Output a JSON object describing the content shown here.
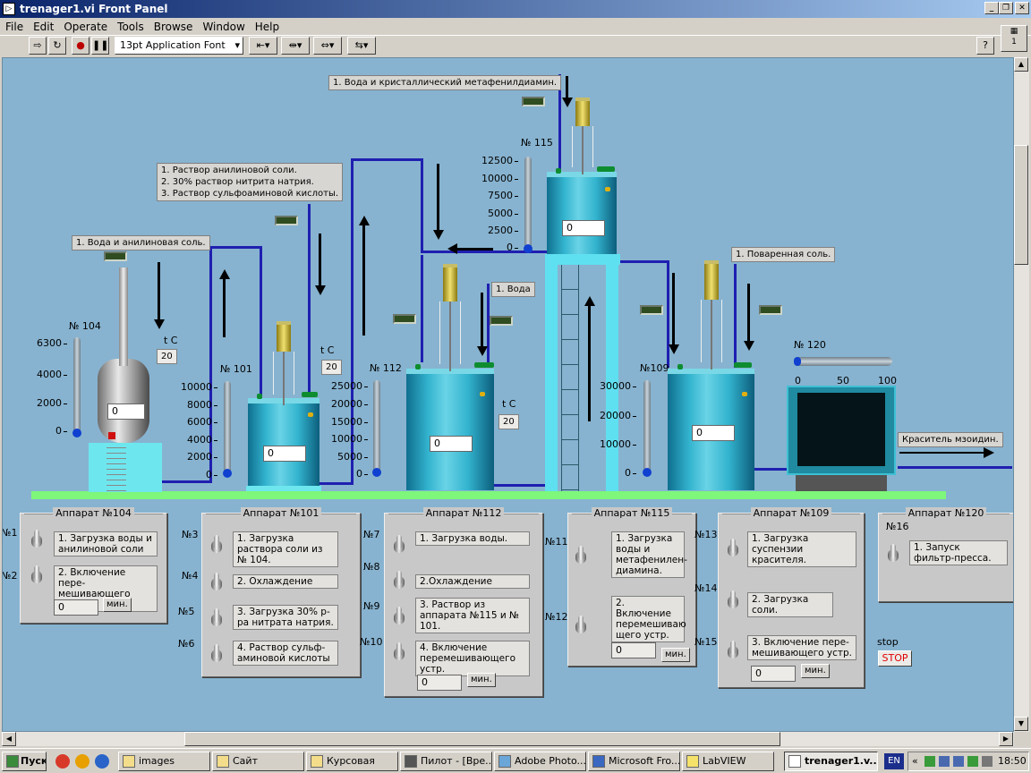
{
  "window": {
    "title": "trenager1.vi Front Panel",
    "icon": "labview-icon"
  },
  "menu": [
    "File",
    "Edit",
    "Operate",
    "Tools",
    "Browse",
    "Window",
    "Help"
  ],
  "toolbar": {
    "font": "13pt Application Font",
    "palette_number": "1"
  },
  "colors": {
    "panel": "#87b3d0",
    "pipe": "#1f1fb0",
    "ground": "#7ef77a",
    "tank": "#33b4cf"
  },
  "inlets": {
    "i104": "1. Вода и анилиновая соль.",
    "i101": [
      "1. Раствор анилиновой соли.",
      "2. 30% раствор нитрита натрия.",
      "3. Раствор сульфоаминовой кислоты."
    ],
    "i115": "1. Вода и кристаллический метафенилдиамин.",
    "i112": "1. Вода",
    "i109": "1. Поваренная соль."
  },
  "outlet": "Краситель мзоидин.",
  "tanks": {
    "t104": {
      "name": "№ 104",
      "value": "0",
      "ticks": [
        "6300",
        "4000",
        "2000",
        "0"
      ]
    },
    "t101": {
      "name": "№ 101",
      "value": "0",
      "ticks": [
        "10000",
        "8000",
        "6000",
        "4000",
        "2000",
        "0"
      ]
    },
    "t112": {
      "name": "№ 112",
      "value": "0",
      "ticks": [
        "25000",
        "20000",
        "15000",
        "10000",
        "5000",
        "0"
      ]
    },
    "t115": {
      "name": "№ 115",
      "value": "0",
      "ticks": [
        "12500",
        "10000",
        "7500",
        "5000",
        "2500",
        "0"
      ]
    },
    "t109": {
      "name": "№109",
      "value": "0",
      "ticks": [
        "30000",
        "20000",
        "10000",
        "0"
      ]
    },
    "t120": {
      "name": "№ 120",
      "ticks": [
        "0",
        "50",
        "100"
      ]
    }
  },
  "temps": {
    "label": "t C",
    "t104": "20",
    "t101": "20",
    "t112": "20"
  },
  "panels": {
    "a104": {
      "title": "Аппарат №104",
      "items": [
        {
          "n": "№1",
          "label": "1. Загрузка воды и анилиновой соли"
        },
        {
          "n": "№2",
          "label": "2. Включение пере-мешивающего устр."
        }
      ],
      "time": "0",
      "unit": "мин."
    },
    "a101": {
      "title": "Аппарат №101",
      "items": [
        {
          "n": "№3",
          "label": "1. Загрузка раствора соли из № 104."
        },
        {
          "n": "№4",
          "label": "2. Охлаждение"
        },
        {
          "n": "№5",
          "label": "3. Загрузка 30% р-ра нитрата натрия."
        },
        {
          "n": "№6",
          "label": "4. Раствор сульф-аминовой кислоты"
        }
      ]
    },
    "a112": {
      "title": "Аппарат №112",
      "items": [
        {
          "n": "№7",
          "label": "1. Загрузка воды."
        },
        {
          "n": "№8",
          "label": "2.Охлаждение"
        },
        {
          "n": "№9",
          "label": "3. Раствор из аппарата №115 и № 101."
        },
        {
          "n": "№10",
          "label": "4. Включение перемешивающего устр."
        }
      ],
      "time": "0",
      "unit": "мин."
    },
    "a115": {
      "title": "Аппарат №115",
      "items": [
        {
          "n": "№11",
          "label": "1. Загрузка воды и метафенилен-диамина."
        },
        {
          "n": "№12",
          "label": "2. Включение перемешиваю щего устр."
        }
      ],
      "time": "0",
      "unit": "мин."
    },
    "a109": {
      "title": "Аппарат №109",
      "items": [
        {
          "n": "№13",
          "label": "1. Загрузка суспензии красителя."
        },
        {
          "n": "№14",
          "label": "2. Загрузка соли."
        },
        {
          "n": "№15",
          "label": "3. Включение пере-мешивающего устр."
        }
      ],
      "time": "0",
      "unit": "мин."
    },
    "a120": {
      "title": "Аппарат №120",
      "items": [
        {
          "n": "№16",
          "label": "1. Запуск фильтр-пресса."
        }
      ]
    }
  },
  "stop": {
    "label": "stop",
    "button": "STOP"
  },
  "taskbar": {
    "start": "Пуск",
    "items": [
      "images",
      "Сайт",
      "Курсовая",
      "Пилот - [Вре...",
      "Adobe Photo...",
      "Microsoft Fro...",
      "LabVIEW",
      "trenager1.v..."
    ],
    "lang": "EN",
    "time": "18:50"
  }
}
